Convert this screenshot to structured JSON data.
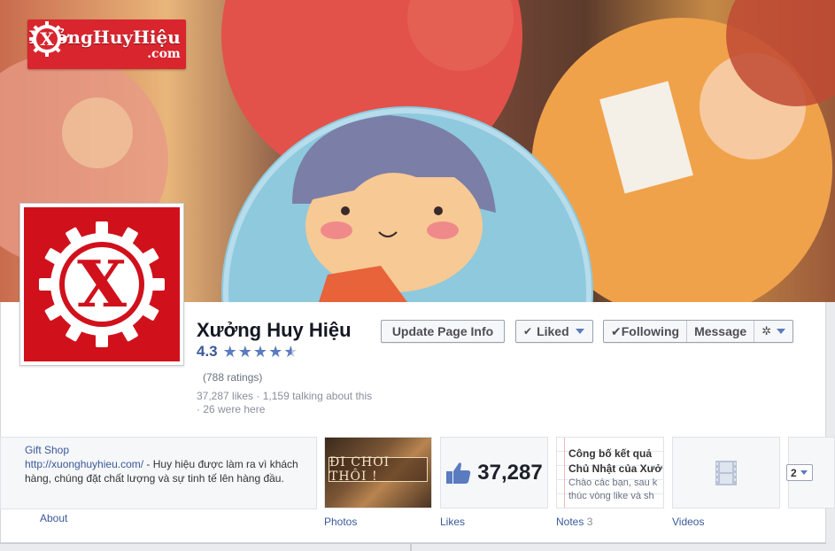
{
  "cover": {
    "logo_main": "XưởngHuyHiệu",
    "logo_sub": ".com"
  },
  "page": {
    "name": "Xưởng Huy Hiệu",
    "rating": "4.3",
    "rating_value": 4.3,
    "ratings_count": "(788 ratings)",
    "stats": "37,287 likes · 1,159 talking about this · 26 were here"
  },
  "actions": {
    "update_label": "Update Page Info",
    "liked_label": "Liked",
    "following_label": "Following",
    "message_label": "Message"
  },
  "about": {
    "category": "Gift Shop",
    "link": "http://xuonghuyhieu.com/",
    "description": " - Huy hiệu được làm ra vì khách hàng, chúng đặt chất lượng và sự tinh tế lên hàng đầu.",
    "label": "About"
  },
  "tiles": {
    "photos": {
      "label": "Photos",
      "banner": "ĐI CHƠI THÔI !"
    },
    "likes": {
      "label": "Likes",
      "count": "37,287"
    },
    "notes": {
      "label": "Notes",
      "count": "3",
      "title_line1": "Công bố kết quả",
      "title_line2": "Chủ Nhật của Xưở",
      "body_line1": "Chào các bạn, sau k",
      "body_line2": "thúc vòng like và sh"
    },
    "videos": {
      "label": "Videos"
    },
    "more": {
      "value": "2"
    }
  },
  "colors": {
    "brand_red": "#d0111c",
    "link_blue": "#3b5998",
    "star_blue": "#5b7bc0"
  }
}
